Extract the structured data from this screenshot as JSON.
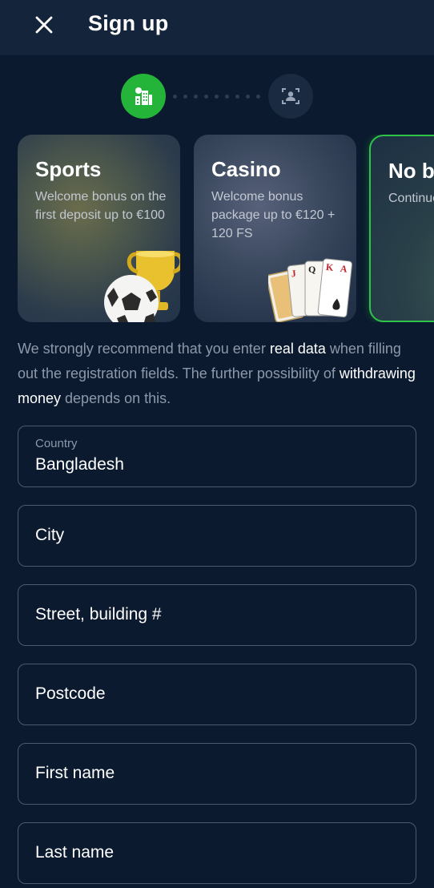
{
  "header": {
    "title": "Sign up",
    "close_icon": "close-icon"
  },
  "stepper": {
    "steps": [
      {
        "icon": "city-icon",
        "active": true
      },
      {
        "icon": "id-scan-icon",
        "active": false
      }
    ],
    "colors": {
      "active": "#25b43a",
      "inactive": "#1a2a40"
    }
  },
  "bonuses": [
    {
      "title": "Sports",
      "description": "Welcome bonus on the first deposit up to €100",
      "art": "trophy-football"
    },
    {
      "title": "Casino",
      "description": "Welcome bonus package up to €120 + 120 FS",
      "art": "playing-cards"
    },
    {
      "title": "No bonus",
      "description": "Continue without bonus",
      "selected": true
    }
  ],
  "notice": {
    "part1": "We strongly recommend that you enter ",
    "highlight1": "real data",
    "part2": " when filling out the registration fields. The further possibility of ",
    "highlight2": "withdrawing money",
    "part3": " depends on this."
  },
  "form": {
    "country": {
      "label": "Country",
      "value": "Bangladesh"
    },
    "city": {
      "placeholder": "City"
    },
    "street": {
      "placeholder": "Street, building #"
    },
    "postcode": {
      "placeholder": "Postcode"
    },
    "first_name": {
      "placeholder": "First name"
    },
    "last_name": {
      "placeholder": "Last name"
    }
  },
  "colors": {
    "background": "#0b1a2e",
    "header": "#14243a",
    "accent": "#2ec447",
    "border": "#4a5a72",
    "muted_text": "#8d99ab"
  }
}
